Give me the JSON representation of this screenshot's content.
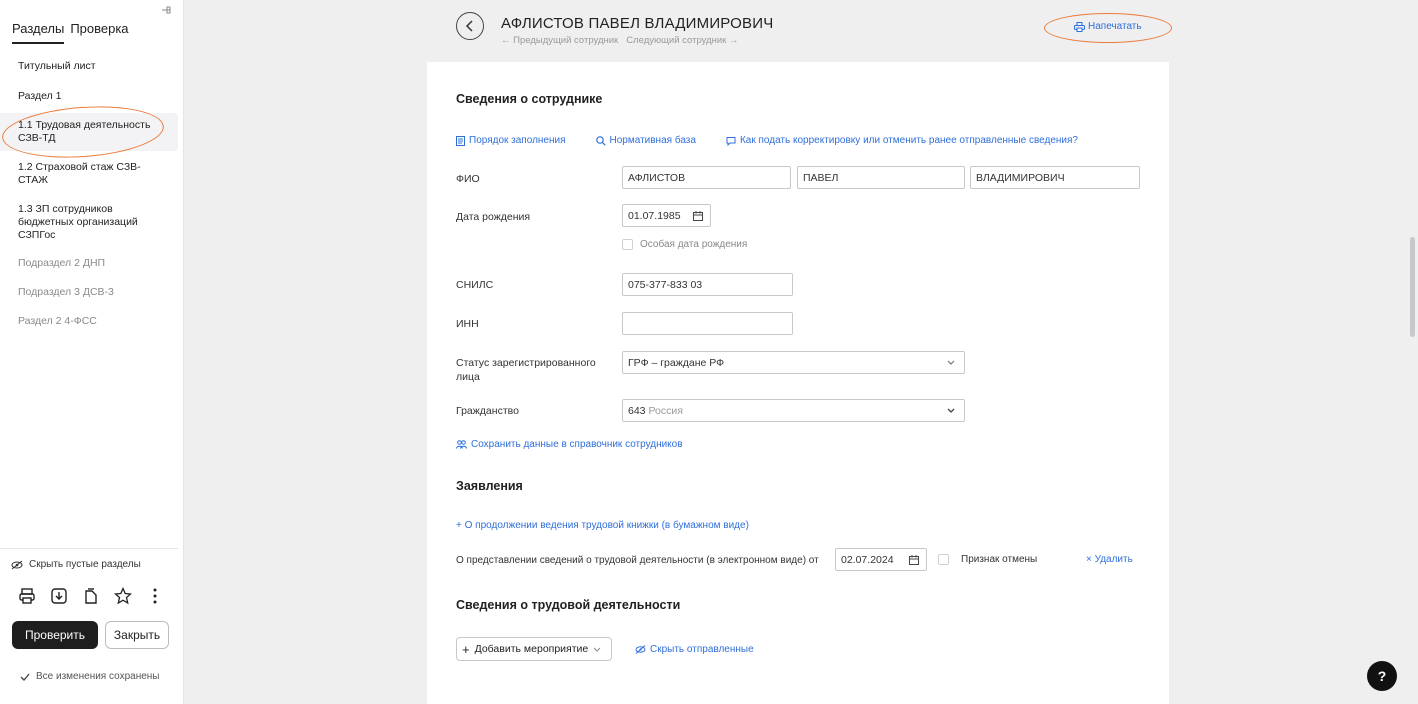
{
  "sidebar": {
    "tabs": [
      "Разделы",
      "Проверка"
    ],
    "items": [
      {
        "label": "Титульный лист"
      },
      {
        "label": "Раздел 1"
      },
      {
        "label": "1.1 Трудовая деятельность СЗВ-ТД"
      },
      {
        "label": "1.2 Страховой стаж СЗВ-СТАЖ"
      },
      {
        "label": "1.3 ЗП сотрудников бюджетных организаций СЗПГос"
      },
      {
        "label": "Подраздел 2 ДНП"
      },
      {
        "label": "Подраздел 3 ДСВ-3"
      },
      {
        "label": "Раздел 2 4-ФСС"
      }
    ],
    "hide_empty": "Скрыть пустые разделы",
    "check_button": "Проверить",
    "close_button": "Закрыть",
    "saved_status": "Все изменения сохранены"
  },
  "header": {
    "employee_name": "АФЛИСТОВ ПАВЕЛ ВЛАДИМИРОВИЧ",
    "prev": "← Предыдущий сотрудник",
    "next": "Следующий сотрудник →",
    "print": "Напечатать"
  },
  "employee": {
    "title": "Сведения о сотруднике",
    "links": [
      "Порядок заполнения",
      "Нормативная база",
      "Как подать корректировку или отменить ранее отправленные сведения?"
    ],
    "fio_label": "ФИО",
    "last_name": "АФЛИСТОВ",
    "first_name": "ПАВЕЛ",
    "middle_name": "ВЛАДИМИРОВИЧ",
    "birth_label": "Дата рождения",
    "birth_date": "01.07.1985",
    "special_birth": "Особая дата рождения",
    "snils_label": "СНИЛС",
    "snils": "075-377-833 03",
    "inn_label": "ИНН",
    "inn": "",
    "status_label": "Статус зарегистрированного лица",
    "status_value": "ГРФ – граждане РФ",
    "citizenship_label": "Гражданство",
    "citizenship_code": "643",
    "citizenship_name": "Россия",
    "save_link": "Сохранить данные в справочник сотрудников"
  },
  "statements": {
    "title": "Заявления",
    "add_link": "+ О продолжении ведения трудовой книжки (в бумажном виде)",
    "row_label": "О представлении сведений о трудовой деятельности (в электронном виде) от",
    "row_date": "02.07.2024",
    "cancel_flag": "Признак отмены",
    "delete": "× Удалить"
  },
  "activity": {
    "title": "Сведения о трудовой деятельности",
    "add_button": "Добавить мероприятие",
    "hide_sent": "Скрыть отправленные"
  },
  "help": "?"
}
